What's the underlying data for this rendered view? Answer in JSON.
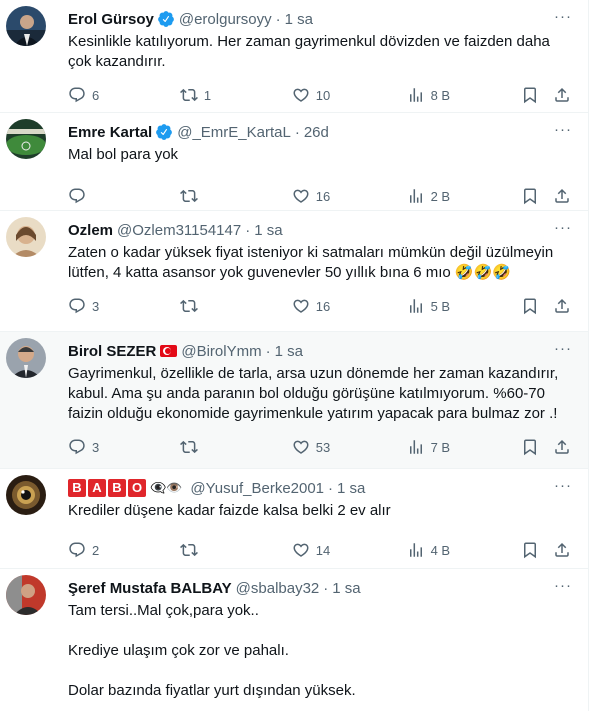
{
  "tweets": [
    {
      "name": "Erol Gürsoy",
      "verified": true,
      "handle": "@erolgursoyy",
      "time": "1 sa",
      "text": [
        "Kesinlikle katılıyorum. Her zaman gayrimenkul dövizden ve faizden daha çok kazandırır."
      ],
      "replies": "6",
      "retweets": "1",
      "likes": "10",
      "views": "8 B"
    },
    {
      "name": "Emre Kartal",
      "verified": true,
      "handle": "@_EmrE_KartaL",
      "time": "26d",
      "text": [
        "Mal bol para yok"
      ],
      "replies": "",
      "retweets": "",
      "likes": "16",
      "views": "2 B"
    },
    {
      "name": "Ozlem",
      "verified": false,
      "handle": "@Ozlem31154147",
      "time": "1 sa",
      "text": [
        "Zaten o kadar yüksek fiyat isteniyor ki satmaları mümkün değil üzülmeyin lütfen, 4 katta asansor yok guvenevler 50 yıllık bına 6 mıo 🤣🤣🤣"
      ],
      "replies": "3",
      "retweets": "",
      "likes": "16",
      "views": "5 B"
    },
    {
      "name": "Birol SEZER",
      "verified": false,
      "handle": "@BirolYmm",
      "time": "1 sa",
      "text": [
        "Gayrimenkul, özellikle de tarla, arsa uzun dönemde her zaman kazandırır, kabul. Ama şu anda paranın bol olduğu görüşüne katılmıyorum. %60-70 faizin olduğu ekonomide gayrimenkule yatırım yapacak para bulmaz zor .!"
      ],
      "replies": "3",
      "retweets": "",
      "likes": "53",
      "views": "7 B"
    },
    {
      "name_letters": [
        "B",
        "A",
        "B",
        "O"
      ],
      "name_emoji": "👁️‍🗨️👁️",
      "handle": "@Yusuf_Berke2001",
      "time": "1 sa",
      "text": [
        "Krediler düşene kadar faizde kalsa belki 2 ev alır"
      ],
      "replies": "2",
      "retweets": "",
      "likes": "14",
      "views": "4 B"
    },
    {
      "name": "Şeref Mustafa BALBAY",
      "verified": false,
      "handle": "@sbalbay32",
      "time": "1 sa",
      "text": [
        "Tam tersi..Mal çok,para yok..",
        "Krediye ulaşım çok zor ve pahalı.",
        "Dolar bazında fiyatlar yurt dışından yüksek."
      ]
    }
  ],
  "colors": {
    "verified": "#1d9bf0",
    "secondary": "#536471",
    "highlight_bg": "#f7f9f9"
  },
  "icons": [
    "reply-icon",
    "retweet-icon",
    "like-icon",
    "views-icon",
    "bookmark-icon",
    "share-icon",
    "more-icon",
    "verified-badge-icon",
    "turkey-flag-icon"
  ]
}
